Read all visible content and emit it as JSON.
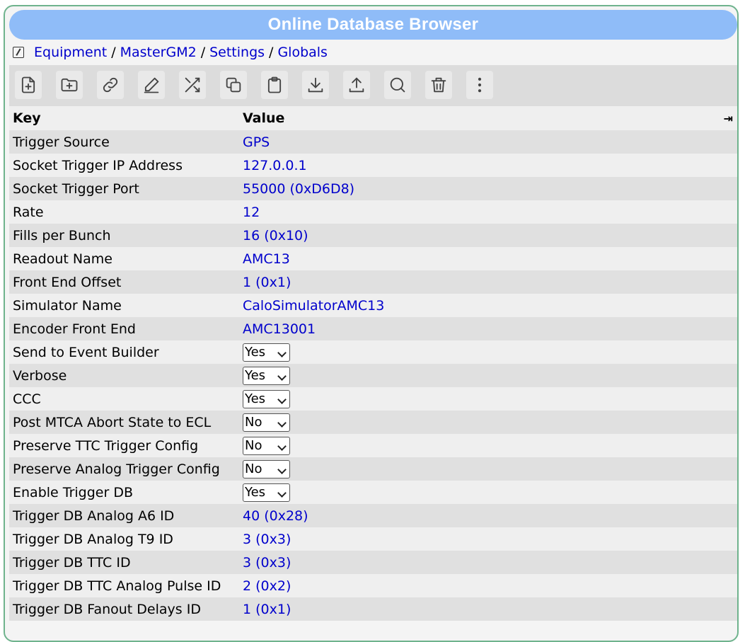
{
  "title": "Online Database Browser",
  "breadcrumb": {
    "items": [
      "Equipment",
      "MasterGM2",
      "Settings",
      "Globals"
    ],
    "separator": "/"
  },
  "toolbar": {
    "buttons": [
      "new-key-icon",
      "new-subdir-icon",
      "link-icon",
      "edit-icon",
      "shuffle-icon",
      "copy-icon",
      "paste-icon",
      "download-icon",
      "upload-icon",
      "search-icon",
      "delete-icon",
      "more-icon"
    ]
  },
  "table": {
    "headers": {
      "key": "Key",
      "value": "Value",
      "expand": "⇥"
    },
    "rows": [
      {
        "key": "Trigger Source",
        "value": "GPS"
      },
      {
        "key": "Socket Trigger IP Address",
        "value": "127.0.0.1"
      },
      {
        "key": "Socket Trigger Port",
        "value": "55000 (0xD6D8)"
      },
      {
        "key": "Rate",
        "value": "12"
      },
      {
        "key": "Fills per Bunch",
        "value": "16 (0x10)"
      },
      {
        "key": "Readout Name",
        "value": "AMC13"
      },
      {
        "key": "Front End Offset",
        "value": "1 (0x1)"
      },
      {
        "key": "Simulator Name",
        "value": "CaloSimulatorAMC13"
      },
      {
        "key": "Encoder Front End",
        "value": "AMC13001"
      },
      {
        "key": "Send to Event Builder",
        "select": "Yes"
      },
      {
        "key": "Verbose",
        "select": "Yes"
      },
      {
        "key": "CCC",
        "select": "Yes"
      },
      {
        "key": "Post MTCA Abort State to ECL",
        "select": "No"
      },
      {
        "key": "Preserve TTC Trigger Config",
        "select": "No"
      },
      {
        "key": "Preserve Analog Trigger Config",
        "select": "No"
      },
      {
        "key": "Enable Trigger DB",
        "select": "Yes"
      },
      {
        "key": "Trigger DB Analog A6 ID",
        "value": "40 (0x28)"
      },
      {
        "key": "Trigger DB Analog T9 ID",
        "value": "3 (0x3)"
      },
      {
        "key": "Trigger DB TTC ID",
        "value": "3 (0x3)"
      },
      {
        "key": "Trigger DB TTC Analog Pulse ID",
        "value": "2 (0x2)"
      },
      {
        "key": "Trigger DB Fanout Delays ID",
        "value": "1 (0x1)"
      }
    ]
  },
  "colors": {
    "title_bar": "#8fbcf8",
    "frame_border": "#6fb38d",
    "link": "#0000cc",
    "row_odd": "#e0e0e0",
    "row_even": "#efefef"
  }
}
